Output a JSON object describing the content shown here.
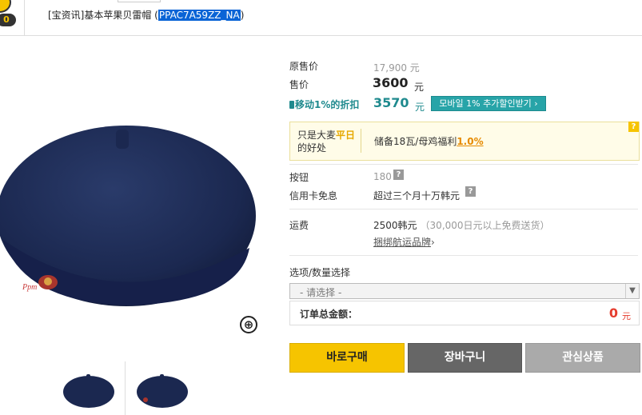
{
  "header": {
    "badge_count": "0",
    "title_prefix": "[宝资讯]基本苹果贝雷帽 (",
    "product_code": "PPAC7A59ZZ_NA",
    "title_suffix": ")"
  },
  "price": {
    "original_label": "原售价",
    "original_value": "17,900 元",
    "sale_label": "售价",
    "sale_value": "3600",
    "sale_unit": "元",
    "mobile_label": "移动1%的折扣",
    "mobile_value": "3570",
    "mobile_unit": "元",
    "mobile_button": "모바일 1% 추가할인받기 ›"
  },
  "benefit": {
    "title_a": "只是大麦",
    "title_b": "平日",
    "title_c": "的好处",
    "desc_prefix": "储备18瓦/母鸡福利",
    "desc_rate": "1.0%",
    "help": "?"
  },
  "info": {
    "points_label": "按钮",
    "points_value": "180",
    "card_label": "信用卡免息",
    "card_value": "超过三个月十万韩元",
    "help": "?"
  },
  "shipping": {
    "label": "运费",
    "value": "2500韩元",
    "note": "（30,000日元以上免费送货）",
    "link": "捆绑航运品牌",
    "link_arrow": "›"
  },
  "option": {
    "label": "选项/数量选择",
    "placeholder": "- 请选择 -",
    "total_label": "订单总金额：",
    "total_value": "0",
    "total_unit": "元"
  },
  "buttons": {
    "buy": "바로구매",
    "cart": "장바구니",
    "wish": "관심상품"
  },
  "icons": {
    "zoom": "⊕"
  }
}
